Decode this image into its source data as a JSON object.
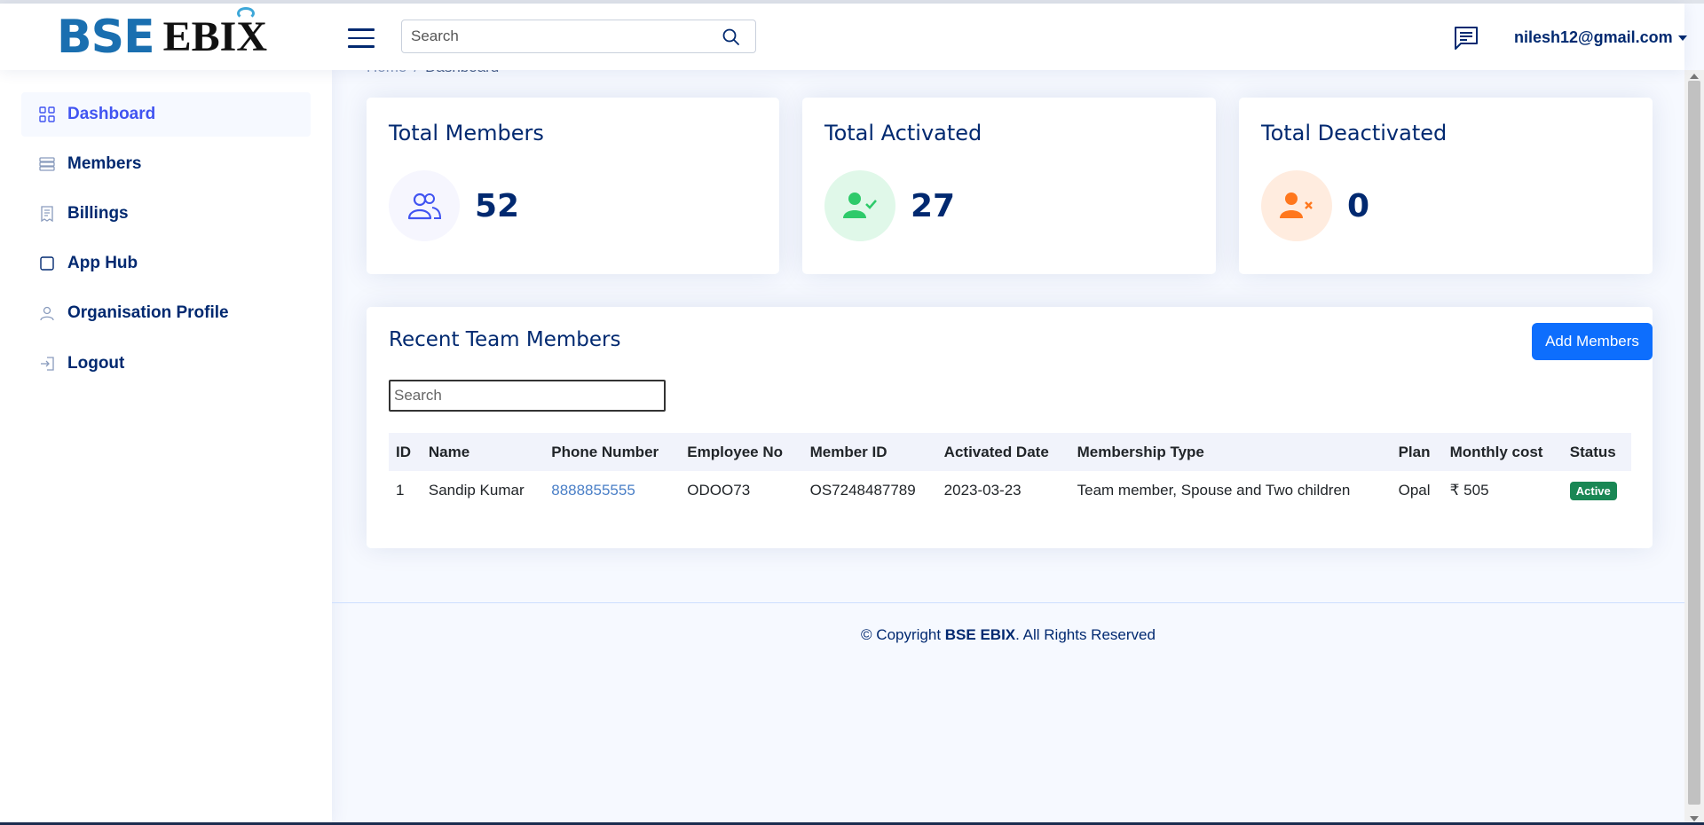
{
  "brand": {
    "logo_main": "BSE",
    "logo_sub": "EBIX"
  },
  "header": {
    "search_placeholder": "Search",
    "user_email": "nilesh12@gmail.com"
  },
  "sidebar": {
    "items": [
      {
        "label": "Dashboard",
        "icon": "grid-icon",
        "active": true
      },
      {
        "label": "Members",
        "icon": "server-icon"
      },
      {
        "label": "Billings",
        "icon": "receipt-icon"
      },
      {
        "label": "App Hub",
        "icon": "square-icon"
      },
      {
        "label": "Organisation Profile",
        "icon": "person-icon"
      },
      {
        "label": "Logout",
        "icon": "logout-icon"
      }
    ]
  },
  "breadcrumb": {
    "home": "Home",
    "separator": "/",
    "current": "Dashboard"
  },
  "stats": [
    {
      "title": "Total Members",
      "value": "52",
      "icon": "people-icon",
      "color": "#4154f1",
      "bg": "#f6f6fe"
    },
    {
      "title": "Total Activated",
      "value": "27",
      "icon": "person-check-icon",
      "color": "#2eca6a",
      "bg": "#e0f8e9"
    },
    {
      "title": "Total Deactivated",
      "value": "0",
      "icon": "person-x-icon",
      "color": "#ff771d",
      "bg": "#ffecdf"
    }
  ],
  "recent": {
    "title": "Recent Team Members",
    "add_button": "Add Members",
    "search_placeholder": "Search",
    "columns": [
      "ID",
      "Name",
      "Phone Number",
      "Employee No",
      "Member ID",
      "Activated Date",
      "Membership Type",
      "Plan",
      "Monthly cost",
      "Status"
    ],
    "rows": [
      {
        "id": "1",
        "name": "Sandip Kumar",
        "phone": "8888855555",
        "employee_no": "ODOO73",
        "member_id": "OS7248487789",
        "activated_date": "2023-03-23",
        "membership_type": "Team member, Spouse and Two children",
        "plan": "Opal",
        "monthly_cost": "₹ 505",
        "status": "Active"
      }
    ]
  },
  "footer": {
    "prefix": "© Copyright ",
    "brand": "BSE EBIX",
    "suffix": ". All Rights Reserved"
  }
}
